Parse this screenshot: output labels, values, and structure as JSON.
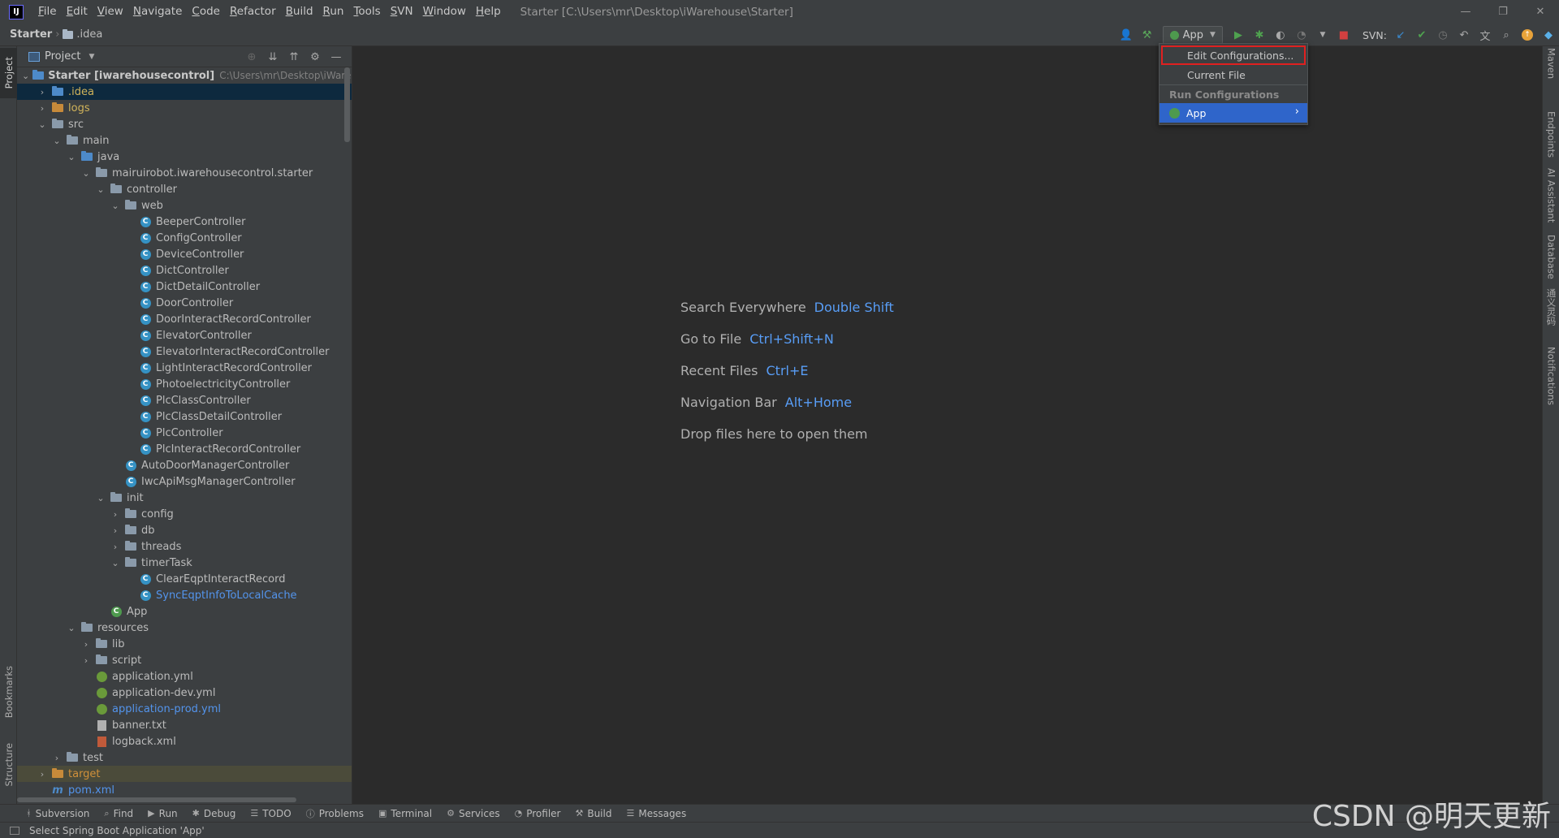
{
  "menu": {
    "items": [
      {
        "label": "File",
        "key": "F",
        "rest": "ile"
      },
      {
        "label": "Edit",
        "key": "E",
        "rest": "dit"
      },
      {
        "label": "View",
        "key": "V",
        "rest": "iew"
      },
      {
        "label": "Navigate",
        "key": "N",
        "rest": "avigate"
      },
      {
        "label": "Code",
        "key": "C",
        "rest": "ode"
      },
      {
        "label": "Refactor",
        "key": "R",
        "rest": "efactor"
      },
      {
        "label": "Build",
        "key": "B",
        "rest": "uild"
      },
      {
        "label": "Run",
        "key": "R",
        "rest": "un"
      },
      {
        "label": "Tools",
        "key": "T",
        "rest": "ools"
      },
      {
        "label": "SVN",
        "key": "S",
        "rest": "VN"
      },
      {
        "label": "Window",
        "key": "W",
        "rest": "indow"
      },
      {
        "label": "Help",
        "key": "H",
        "rest": "elp"
      }
    ],
    "window_title": "Starter [C:\\Users\\mr\\Desktop\\iWarehouse\\Starter]"
  },
  "navbar": {
    "crumb_root": "Starter",
    "crumb_child": ".idea",
    "run_config": "App",
    "svn_label": "SVN:"
  },
  "project_panel": {
    "title": "Project",
    "tree": [
      {
        "depth": 0,
        "arrow": "open",
        "icon": "module",
        "text": "Starter [iwarehousecontrol]",
        "extra": "C:\\Users\\mr\\Desktop\\iWarehouse",
        "style": "bold"
      },
      {
        "depth": 1,
        "arrow": "closed",
        "icon": "folder-blue",
        "text": ".idea",
        "style": "yellow",
        "selected": true
      },
      {
        "depth": 1,
        "arrow": "closed",
        "icon": "folder-orange",
        "text": "logs",
        "style": "yellow"
      },
      {
        "depth": 1,
        "arrow": "open",
        "icon": "folder",
        "text": "src"
      },
      {
        "depth": 2,
        "arrow": "open",
        "icon": "folder",
        "text": "main"
      },
      {
        "depth": 3,
        "arrow": "open",
        "icon": "folder-blue",
        "text": "java"
      },
      {
        "depth": 4,
        "arrow": "open",
        "icon": "folder",
        "text": "mairuirobot.iwarehousecontrol.starter"
      },
      {
        "depth": 5,
        "arrow": "open",
        "icon": "folder",
        "text": "controller"
      },
      {
        "depth": 6,
        "arrow": "open",
        "icon": "folder",
        "text": "web"
      },
      {
        "depth": 7,
        "arrow": "none",
        "icon": "class",
        "text": "BeeperController"
      },
      {
        "depth": 7,
        "arrow": "none",
        "icon": "class",
        "text": "ConfigController"
      },
      {
        "depth": 7,
        "arrow": "none",
        "icon": "class",
        "text": "DeviceController"
      },
      {
        "depth": 7,
        "arrow": "none",
        "icon": "class",
        "text": "DictController"
      },
      {
        "depth": 7,
        "arrow": "none",
        "icon": "class",
        "text": "DictDetailController"
      },
      {
        "depth": 7,
        "arrow": "none",
        "icon": "class",
        "text": "DoorController"
      },
      {
        "depth": 7,
        "arrow": "none",
        "icon": "class",
        "text": "DoorInteractRecordController"
      },
      {
        "depth": 7,
        "arrow": "none",
        "icon": "class",
        "text": "ElevatorController"
      },
      {
        "depth": 7,
        "arrow": "none",
        "icon": "class",
        "text": "ElevatorInteractRecordController"
      },
      {
        "depth": 7,
        "arrow": "none",
        "icon": "class",
        "text": "LightInteractRecordController"
      },
      {
        "depth": 7,
        "arrow": "none",
        "icon": "class",
        "text": "PhotoelectricityController"
      },
      {
        "depth": 7,
        "arrow": "none",
        "icon": "class",
        "text": "PlcClassController"
      },
      {
        "depth": 7,
        "arrow": "none",
        "icon": "class",
        "text": "PlcClassDetailController"
      },
      {
        "depth": 7,
        "arrow": "none",
        "icon": "class",
        "text": "PlcController"
      },
      {
        "depth": 7,
        "arrow": "none",
        "icon": "class",
        "text": "PlcInteractRecordController"
      },
      {
        "depth": 6,
        "arrow": "none",
        "icon": "class",
        "text": "AutoDoorManagerController"
      },
      {
        "depth": 6,
        "arrow": "none",
        "icon": "class",
        "text": "IwcApiMsgManagerController"
      },
      {
        "depth": 5,
        "arrow": "open",
        "icon": "folder",
        "text": "init"
      },
      {
        "depth": 6,
        "arrow": "closed",
        "icon": "folder",
        "text": "config"
      },
      {
        "depth": 6,
        "arrow": "closed",
        "icon": "folder",
        "text": "db"
      },
      {
        "depth": 6,
        "arrow": "closed",
        "icon": "folder",
        "text": "threads"
      },
      {
        "depth": 6,
        "arrow": "open",
        "icon": "folder",
        "text": "timerTask"
      },
      {
        "depth": 7,
        "arrow": "none",
        "icon": "class",
        "text": "ClearEqptInteractRecord"
      },
      {
        "depth": 7,
        "arrow": "none",
        "icon": "class",
        "text": "SyncEqptInfoToLocalCache",
        "style": "blue"
      },
      {
        "depth": 5,
        "arrow": "none",
        "icon": "class-app",
        "text": "App"
      },
      {
        "depth": 3,
        "arrow": "open",
        "icon": "folder",
        "text": "resources"
      },
      {
        "depth": 4,
        "arrow": "closed",
        "icon": "folder",
        "text": "lib"
      },
      {
        "depth": 4,
        "arrow": "closed",
        "icon": "folder",
        "text": "script"
      },
      {
        "depth": 4,
        "arrow": "none",
        "icon": "yml",
        "text": "application.yml"
      },
      {
        "depth": 4,
        "arrow": "none",
        "icon": "yml",
        "text": "application-dev.yml"
      },
      {
        "depth": 4,
        "arrow": "none",
        "icon": "yml",
        "text": "application-prod.yml",
        "style": "blue"
      },
      {
        "depth": 4,
        "arrow": "none",
        "icon": "txt",
        "text": "banner.txt"
      },
      {
        "depth": 4,
        "arrow": "none",
        "icon": "xml",
        "text": "logback.xml"
      },
      {
        "depth": 2,
        "arrow": "closed",
        "icon": "folder",
        "text": "test"
      },
      {
        "depth": 1,
        "arrow": "closed",
        "icon": "folder-orange",
        "text": "target",
        "style": "orange",
        "selected_soft": true
      },
      {
        "depth": 1,
        "arrow": "none",
        "icon": "pom",
        "text": "pom.xml",
        "style": "blue"
      }
    ]
  },
  "editor": {
    "hints": [
      {
        "label": "Search Everywhere",
        "shortcut": "Double Shift"
      },
      {
        "label": "Go to File",
        "shortcut": "Ctrl+Shift+N"
      },
      {
        "label": "Recent Files",
        "shortcut": "Ctrl+E"
      },
      {
        "label": "Navigation Bar",
        "shortcut": "Alt+Home"
      },
      {
        "label": "Drop files here to open them",
        "shortcut": ""
      }
    ]
  },
  "run_popup": {
    "edit_configurations": "Edit Configurations...",
    "current_file": "Current File",
    "group_label": "Run Configurations",
    "app_item": "App"
  },
  "left_stripe": {
    "project": "Project",
    "bookmarks": "Bookmarks",
    "structure": "Structure"
  },
  "right_stripe": [
    "Maven",
    "Endpoints",
    "AI Assistant",
    "Database",
    "通义灵码",
    "Notifications"
  ],
  "bottom_tabs": [
    {
      "label": "Subversion",
      "icon": "ᚼ"
    },
    {
      "label": "Find",
      "icon": "⌕"
    },
    {
      "label": "Run",
      "icon": "▶"
    },
    {
      "label": "Debug",
      "icon": "✱"
    },
    {
      "label": "TODO",
      "icon": "☰"
    },
    {
      "label": "Problems",
      "icon": "ⓘ"
    },
    {
      "label": "Terminal",
      "icon": "▣"
    },
    {
      "label": "Services",
      "icon": "⚙"
    },
    {
      "label": "Profiler",
      "icon": "◔"
    },
    {
      "label": "Build",
      "icon": "⚒"
    },
    {
      "label": "Messages",
      "icon": "☰"
    }
  ],
  "status": {
    "text": "Select Spring Boot Application 'App'"
  },
  "watermark": "CSDN @明天更新",
  "colors": {
    "accent": "#2f65ca",
    "popup_outline": "#e02020",
    "shortcut": "#589df6"
  }
}
